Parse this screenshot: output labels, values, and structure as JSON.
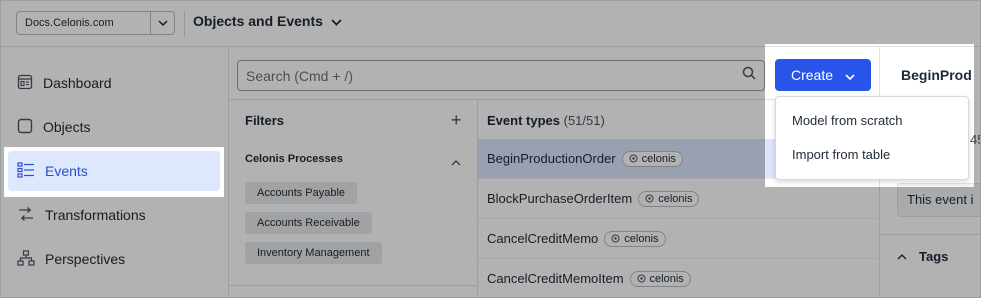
{
  "topbar": {
    "domain": "Docs.Celonis.com",
    "breadcrumb": "Objects and Events"
  },
  "sidebar": {
    "items": [
      {
        "label": "Dashboard",
        "icon": "dashboard-icon"
      },
      {
        "label": "Objects",
        "icon": "object-icon"
      },
      {
        "label": "Events",
        "icon": "events-icon",
        "active": true
      },
      {
        "label": "Transformations",
        "icon": "transformations-icon"
      },
      {
        "label": "Perspectives",
        "icon": "perspectives-icon"
      }
    ]
  },
  "search": {
    "placeholder": "Search (Cmd + /)"
  },
  "create": {
    "label": "Create",
    "menu": [
      "Model from scratch",
      "Import from table"
    ]
  },
  "filters": {
    "title": "Filters",
    "group": "Celonis Processes",
    "chips": [
      "Accounts Payable",
      "Accounts Receivable",
      "Inventory Management"
    ]
  },
  "events": {
    "title": "Event types",
    "count": "(51/51)",
    "rows": [
      {
        "name": "BeginProductionOrder",
        "tag": "celonis"
      },
      {
        "name": "BlockPurchaseOrderItem",
        "tag": "celonis"
      },
      {
        "name": "CancelCreditMemo",
        "tag": "celonis"
      },
      {
        "name": "CancelCreditMemoItem",
        "tag": "celonis"
      }
    ]
  },
  "detail": {
    "title": "BeginProd",
    "number": "45",
    "description": "This event i",
    "tags_label": "Tags"
  },
  "colors": {
    "accent": "#2855e9",
    "active_nav_bg": "#dde8fc",
    "selected_row_bg": "#dbe6fb"
  }
}
